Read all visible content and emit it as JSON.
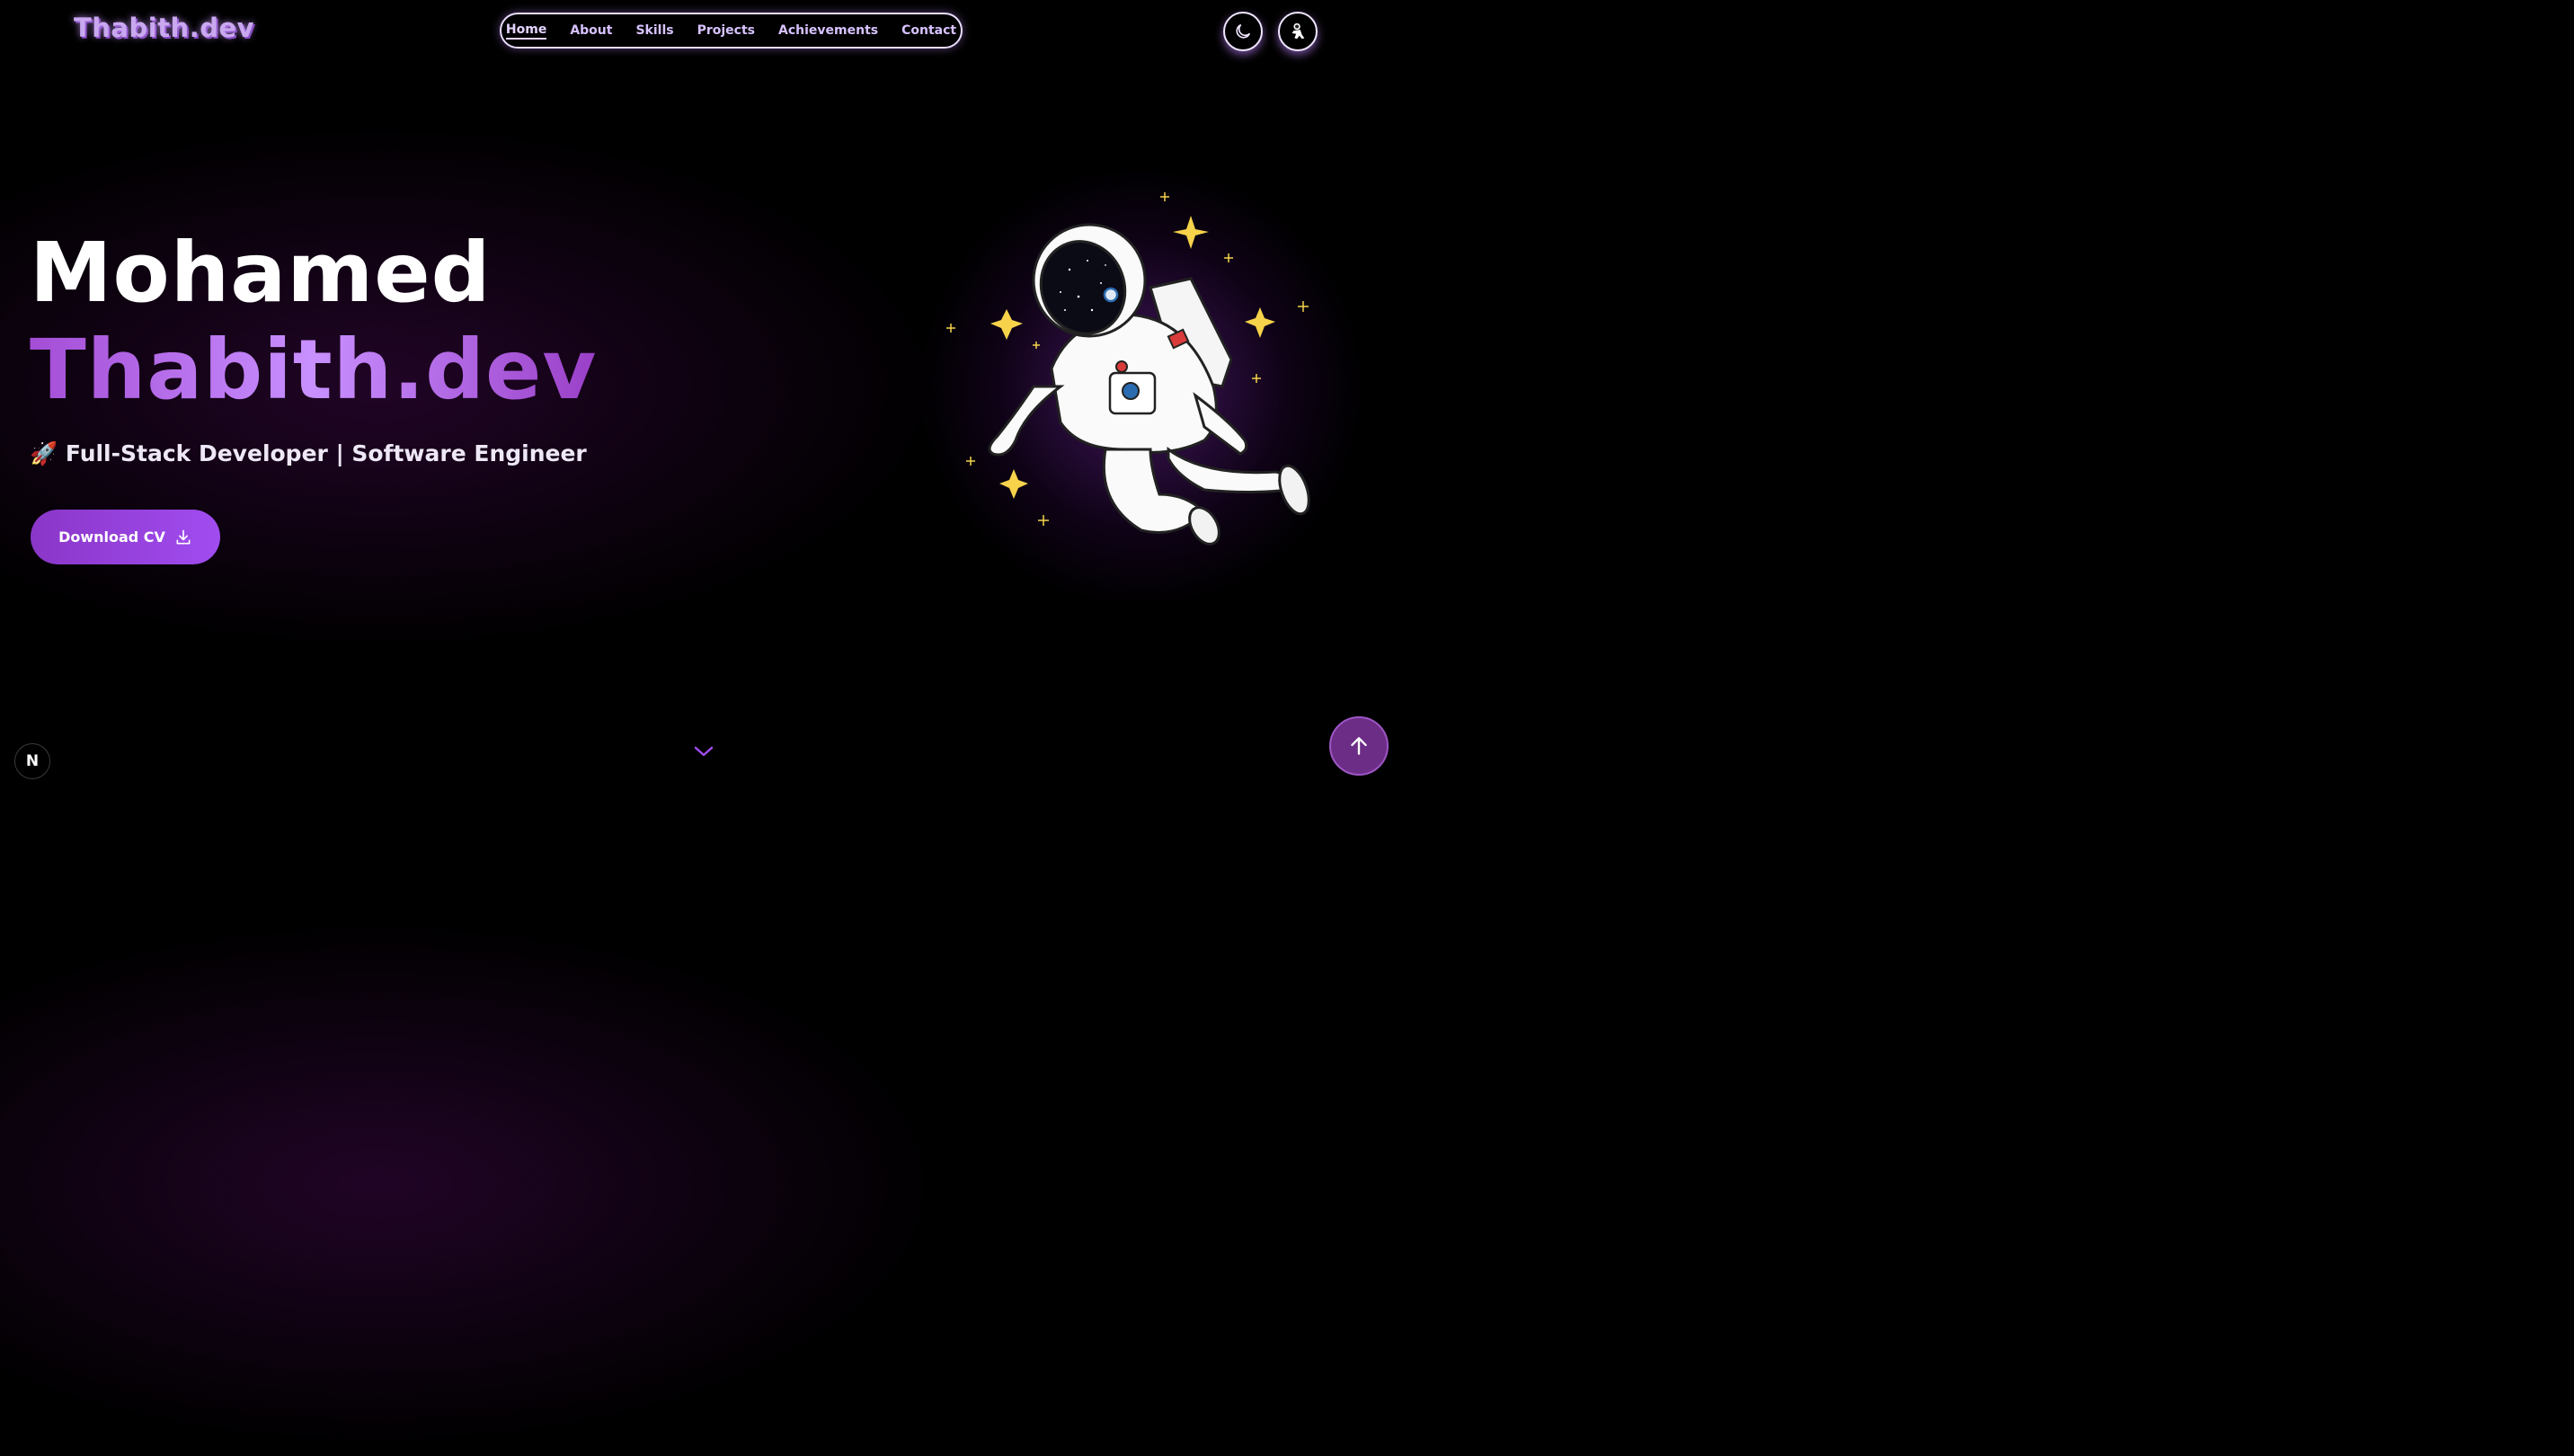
{
  "header": {
    "logo": "Thabith.dev",
    "nav": [
      "Home",
      "About",
      "Skills",
      "Projects",
      "Achievements",
      "Contact"
    ],
    "active_nav": "Home",
    "theme_toggle_icon": "moon-icon",
    "astronaut_button_icon": "astronaut-icon"
  },
  "hero": {
    "first_name": "Mohamed",
    "second_name": "Thabith.dev",
    "emoji": "🚀",
    "subtitle": "Full-Stack Developer | Software Engineer",
    "download_label": "Download CV",
    "download_icon": "download-icon"
  },
  "footer": {
    "scroll_icon": "chevron-down-icon",
    "framework_badge": "N",
    "back_to_top_icon": "arrow-up-icon"
  },
  "colors": {
    "accent": "#a14cf0",
    "nav_text": "#d7c2ff",
    "background": "#000000"
  }
}
